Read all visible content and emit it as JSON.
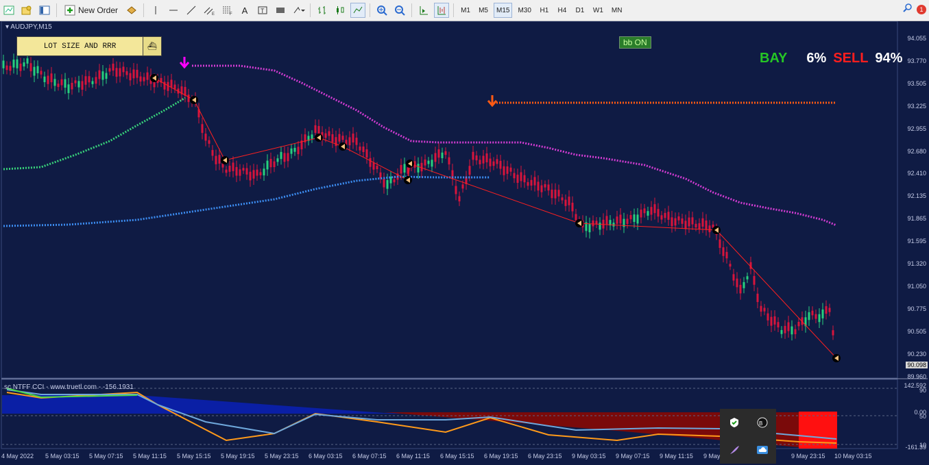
{
  "toolbar": {
    "new_order_label": "New Order",
    "timeframes": [
      "M1",
      "M5",
      "M15",
      "M30",
      "H1",
      "H4",
      "D1",
      "W1",
      "MN"
    ],
    "active_timeframe": "M15",
    "notification_count": "1"
  },
  "chart": {
    "symbol": "AUDJPY,M15",
    "lot_button_label": "LOT SIZE AND RRR",
    "bb_badge": "bb ON",
    "bay_label": "BAY",
    "bay_value": "6%",
    "sell_label": "SELL",
    "sell_value": "94%",
    "current_price": "90.098",
    "price_ticks": [
      "94.055",
      "93.770",
      "93.505",
      "93.225",
      "92.955",
      "92.680",
      "92.410",
      "92.135",
      "91.865",
      "91.595",
      "91.320",
      "91.050",
      "90.775",
      "90.505",
      "90.230",
      "89.960"
    ],
    "indicator_label": "sc NTFF CCI - www.truetl.com - -156.1931",
    "indicator_ticks": [
      "142.592",
      "90",
      "0.00",
      "50",
      "10",
      "-161.39"
    ],
    "time_ticks": [
      "4 May 2022",
      "5 May 03:15",
      "5 May 07:15",
      "5 May 11:15",
      "5 May 15:15",
      "5 May 19:15",
      "5 May 23:15",
      "6 May 03:15",
      "6 May 07:15",
      "6 May 11:15",
      "6 May 15:15",
      "6 May 19:15",
      "6 May 23:15",
      "9 May 03:15",
      "9 May 07:15",
      "9 May 11:15",
      "9 May",
      "9 May 23:15",
      "10 May 03:15"
    ]
  },
  "colors": {
    "background": "#0f1b44",
    "bull": "#27d07e",
    "bear": "#d8143c",
    "ma_magenta": "#d23cd2",
    "ma_blue": "#3c8cf0",
    "ma_green": "#38d27a",
    "sell_level": "#ff5a14",
    "bay": "#25c625",
    "sell": "#ff1e1e"
  }
}
